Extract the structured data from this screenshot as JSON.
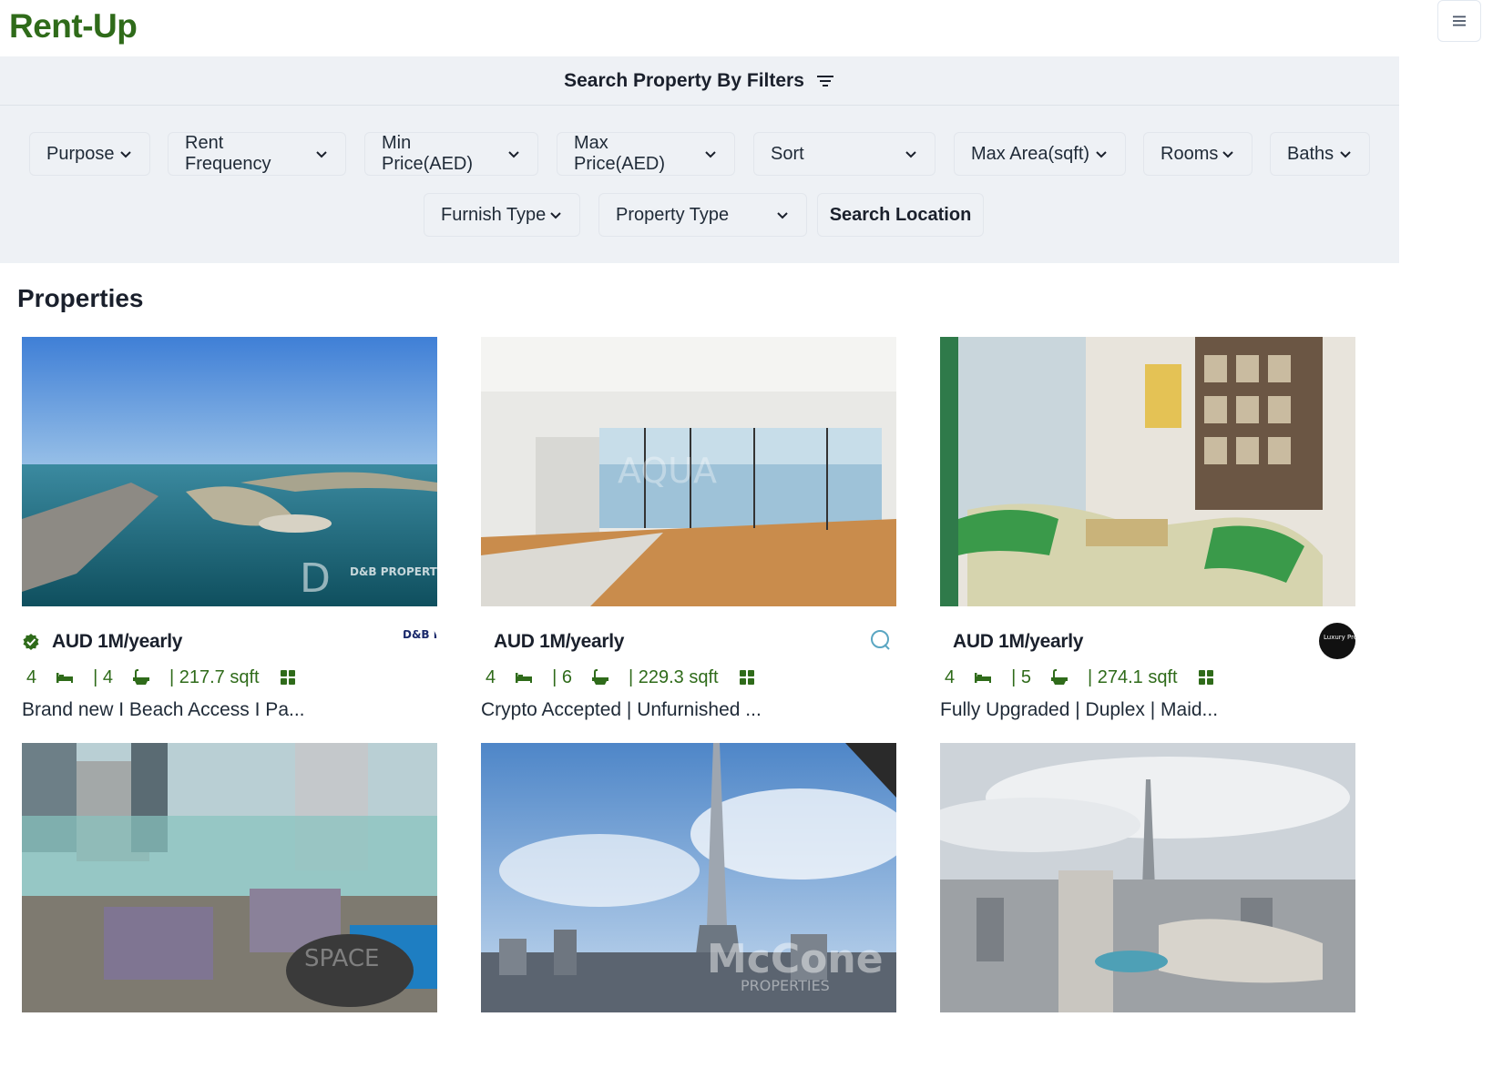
{
  "app": {
    "logo": "Rent-Up"
  },
  "filters": {
    "title": "Search Property By Filters",
    "selects": [
      {
        "label": "Purpose"
      },
      {
        "label": "Rent Frequency"
      },
      {
        "label": "Min Price(AED)"
      },
      {
        "label": "Max Price(AED)"
      },
      {
        "label": "Sort"
      },
      {
        "label": "Max Area(sqft)"
      },
      {
        "label": "Rooms"
      },
      {
        "label": "Baths"
      },
      {
        "label": "Furnish Type"
      },
      {
        "label": "Property Type"
      }
    ],
    "search_location": "Search Location"
  },
  "properties": {
    "title": "Properties",
    "cards": [
      {
        "price": "AUD 1M/yearly",
        "verified": true,
        "rooms": "4",
        "baths": "| 4",
        "area": "| 217.7 sqft",
        "title": "Brand new I Beach Access I Pa...",
        "agency": "D&B PROP",
        "image": "palm-island-aerial"
      },
      {
        "price": "AUD 1M/yearly",
        "verified": false,
        "rooms": "4",
        "baths": "| 6",
        "area": "| 229.3 sqft",
        "title": "Crypto Accepted | Unfurnished ...",
        "agency": "Q",
        "image": "empty-living-room-sea-view"
      },
      {
        "price": "AUD 1M/yearly",
        "verified": false,
        "rooms": "4",
        "baths": "| 5",
        "area": "| 274.1 sqft",
        "title": "Fully Upgraded | Duplex | Maid...",
        "agency": "Luxury Property.com",
        "image": "green-sofa-living-room"
      },
      {
        "price": "",
        "verified": false,
        "rooms": "",
        "baths": "",
        "area": "",
        "title": "",
        "agency": "",
        "image": "terrace-pool-marina"
      },
      {
        "price": "",
        "verified": false,
        "rooms": "",
        "baths": "",
        "area": "",
        "title": "",
        "agency": "",
        "image": "burj-khalifa-view"
      },
      {
        "price": "",
        "verified": false,
        "rooms": "",
        "baths": "",
        "area": "",
        "title": "",
        "agency": "",
        "image": "downtown-dubai-aerial"
      }
    ],
    "watermarks": {
      "card1": "D&B PROPERTIES",
      "card2": "AQUA",
      "card5": "McCone",
      "card5_sub": "PROPERTIES",
      "card4": "SPACE"
    }
  },
  "colors": {
    "brand_green": "#2f6b1a",
    "filter_bg": "#eef1f5"
  },
  "icons": {
    "menu": "hamburger-icon",
    "filter": "filter-lines-icon",
    "bed": "bed-icon",
    "bath": "bath-icon",
    "area": "grid-icon",
    "verified": "verified-badge-icon"
  }
}
